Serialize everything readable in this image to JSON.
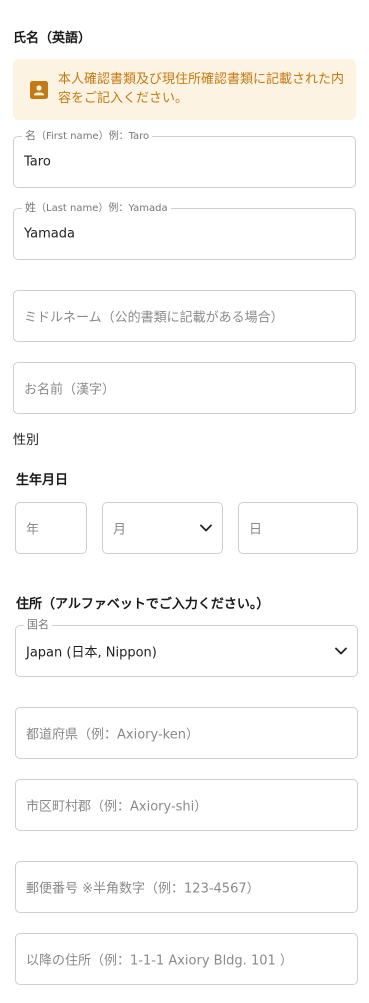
{
  "name_section": {
    "title": "氏名（英語）",
    "notice": "本人確認書類及び現住所確認書類に記載された内容をご記入ください。",
    "first_name": {
      "label": "名",
      "hint": "（First name）例：Taro",
      "value": "Taro"
    },
    "last_name": {
      "label": "姓",
      "hint": "（Last name）例：Yamada",
      "value": "Yamada"
    },
    "middle_name": {
      "placeholder": "ミドルネーム（公的書類に記載がある場合）"
    },
    "kanji_name": {
      "placeholder": "お名前（漢字）"
    },
    "gender_label": "性別"
  },
  "dob_section": {
    "title": "生年月日",
    "year_placeholder": "年",
    "month_placeholder": "月",
    "day_placeholder": "日"
  },
  "address_section": {
    "title": "住所（アルファベットでご入力ください。）",
    "country": {
      "label": "国名",
      "value": "Japan (日本, Nippon)"
    },
    "prefecture_placeholder": "都道府県（例：Axiory-ken）",
    "city_placeholder": "市区町村郡（例：Axiory-shi）",
    "postal_placeholder": "郵便番号 ※半角数字（例：123-4567）",
    "street_placeholder": "以降の住所（例：1-1-1 Axiory Bldg. 101 ）"
  },
  "colors": {
    "notice_bg": "#fdf3e3",
    "notice_text": "#c47a12",
    "border": "#cfcfcf"
  },
  "icons": {
    "notice": "contact-card-icon",
    "select": "chevron-down-icon"
  }
}
